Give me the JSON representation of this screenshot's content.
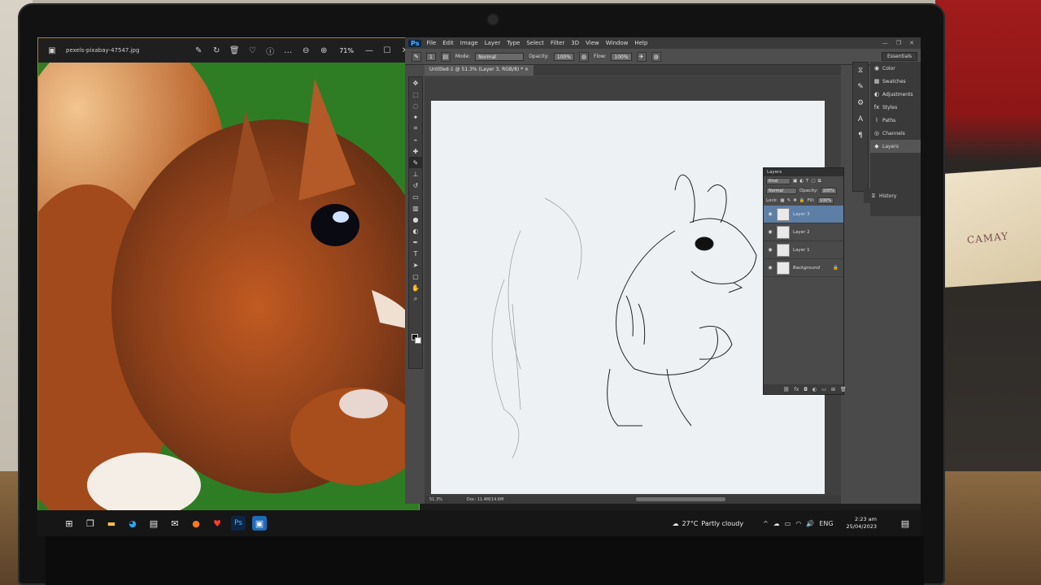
{
  "viewer": {
    "filename": "pexels-pixabay-47547.jpg",
    "zoom": "71%",
    "toolbar_icons": [
      "edit-icon",
      "rotate-icon",
      "delete-icon",
      "heart-icon",
      "info-icon",
      "more-icon",
      "zoom-out-icon",
      "zoom-in-icon"
    ],
    "window_controls": [
      "minimize",
      "maximize",
      "close"
    ]
  },
  "photoshop": {
    "logo": "Ps",
    "menu": [
      "File",
      "Edit",
      "Image",
      "Layer",
      "Type",
      "Select",
      "Filter",
      "3D",
      "View",
      "Window",
      "Help"
    ],
    "options": {
      "brush_size": "1",
      "mode_label": "Mode:",
      "mode_value": "Normal",
      "opacity_label": "Opacity:",
      "opacity_value": "100%",
      "flow_label": "Flow:",
      "flow_value": "100%"
    },
    "workspace": "Essentials",
    "doc_tab": "Untitled-1 @ 51.3% (Layer 3, RGB/8) * ×",
    "status_zoom": "51.3%",
    "status_doc": "Doc: 11.4M/14.6M",
    "dock_panels": [
      {
        "icon": "color-icon",
        "label": "Color"
      },
      {
        "icon": "swatches-icon",
        "label": "Swatches"
      },
      {
        "icon": "adjustments-icon",
        "label": "Adjustments"
      },
      {
        "icon": "styles-icon",
        "label": "Styles"
      },
      {
        "icon": "paths-icon",
        "label": "Paths"
      },
      {
        "icon": "channels-icon",
        "label": "Channels"
      },
      {
        "icon": "layers-icon",
        "label": "Layers"
      }
    ],
    "history_label": "History"
  },
  "layers_panel": {
    "title": "Layers",
    "filter": "Kind",
    "blend_mode": "Normal",
    "opacity_label": "Opacity:",
    "opacity_value": "100%",
    "lock_label": "Lock:",
    "fill_label": "Fill:",
    "fill_value": "100%",
    "layers": [
      {
        "name": "Layer 3",
        "selected": true
      },
      {
        "name": "Layer 2",
        "selected": false
      },
      {
        "name": "Layer 1",
        "selected": false
      },
      {
        "name": "Background",
        "selected": false,
        "locked": true
      }
    ]
  },
  "taskbar": {
    "weather_temp": "27°C",
    "weather_text": "Partly cloudy",
    "language": "ENG",
    "time": "2:23 am",
    "date": "25/04/2023"
  },
  "room": {
    "box_brand": "CAMAY"
  }
}
